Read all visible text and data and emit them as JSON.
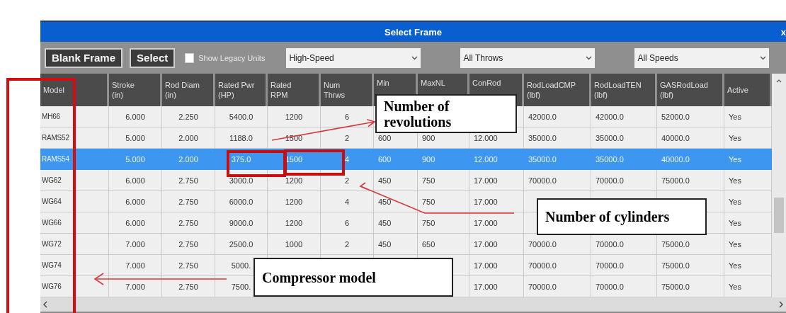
{
  "window": {
    "title": "Select Frame",
    "close": "x"
  },
  "toolbar": {
    "buttons": [
      "Blank Frame",
      "Select"
    ],
    "legacy_units": {
      "label": "Show Legacy Units",
      "checked": false
    },
    "dropdowns": [
      {
        "value": "High-Speed"
      },
      {
        "value": "All Throws"
      },
      {
        "value": "All Speeds"
      }
    ]
  },
  "table": {
    "columns": [
      {
        "lines": [
          "Model"
        ]
      },
      {
        "lines": [
          "Stroke",
          "(in)"
        ]
      },
      {
        "lines": [
          "Rod Diam",
          "(in)"
        ]
      },
      {
        "lines": [
          "Rated Pwr",
          "(HP)"
        ]
      },
      {
        "lines": [
          "Rated",
          "RPM"
        ]
      },
      {
        "lines": [
          "Num",
          "Thrws"
        ]
      },
      {
        "lines": [
          "Min"
        ]
      },
      {
        "lines": [
          "MaxNL"
        ]
      },
      {
        "lines": [
          "ConRod"
        ]
      },
      {
        "lines": [
          "RodLoadCMP",
          "(lbf)"
        ]
      },
      {
        "lines": [
          "RodLoadTEN",
          "(lbf)"
        ]
      },
      {
        "lines": [
          "GASRodLoad",
          "(lbf)"
        ]
      },
      {
        "lines": [
          "Active"
        ]
      }
    ],
    "rows": [
      {
        "selected": false,
        "cells": [
          "MH66",
          "6.000",
          "2.250",
          "5400.0",
          "1200",
          "6",
          null,
          null,
          null,
          "42000.0",
          "42000.0",
          "52000.0",
          "Yes"
        ]
      },
      {
        "selected": false,
        "cells": [
          "RAMS52",
          "5.000",
          "2.000",
          "1188.0",
          "1500",
          "2",
          "600",
          "900",
          "12.000",
          "35000.0",
          "35000.0",
          "40000.0",
          "Yes"
        ]
      },
      {
        "selected": true,
        "cells": [
          "RAMS54",
          "5.000",
          "2.000",
          "375.0",
          "1500",
          "4",
          "600",
          "900",
          "12.000",
          "35000.0",
          "35000.0",
          "40000.0",
          "Yes"
        ]
      },
      {
        "selected": false,
        "cells": [
          "WG62",
          "6.000",
          "2.750",
          "3000.0",
          "1200",
          "2",
          "450",
          "750",
          "17.000",
          "70000.0",
          "70000.0",
          "75000.0",
          "Yes"
        ]
      },
      {
        "selected": false,
        "cells": [
          "WG64",
          "6.000",
          "2.750",
          "6000.0",
          "1200",
          "4",
          "450",
          "750",
          "17.000",
          null,
          null,
          null,
          "Yes"
        ]
      },
      {
        "selected": false,
        "cells": [
          "WG66",
          "6.000",
          "2.750",
          "9000.0",
          "1200",
          "6",
          "450",
          "750",
          "17.000",
          null,
          null,
          null,
          "Yes"
        ]
      },
      {
        "selected": false,
        "cells": [
          "WG72",
          "7.000",
          "2.750",
          "2500.0",
          "1000",
          "2",
          "450",
          "650",
          "17.000",
          "70000.0",
          "70000.0",
          "75000.0",
          "Yes"
        ]
      },
      {
        "selected": false,
        "cells": [
          "WG74",
          "7.000",
          "2.750",
          "5000.",
          null,
          null,
          null,
          null,
          "17.000",
          "70000.0",
          "70000.0",
          "75000.0",
          "Yes"
        ]
      },
      {
        "selected": false,
        "cells": [
          "WG76",
          "7.000",
          "2.750",
          "7500.",
          null,
          null,
          null,
          null,
          "17.000",
          "70000.0",
          "70000.0",
          "75000.0",
          "Yes"
        ]
      }
    ]
  },
  "annotations": {
    "callouts": [
      {
        "text": "Number of revolutions"
      },
      {
        "text": "Number of cylinders"
      },
      {
        "text": "Compressor model"
      }
    ]
  }
}
